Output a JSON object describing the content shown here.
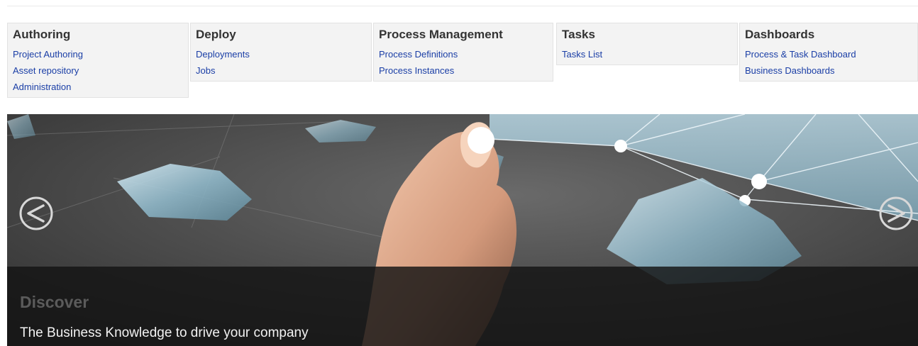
{
  "menu": [
    {
      "heading": "Authoring",
      "links": [
        "Project Authoring",
        "Asset repository",
        "Administration"
      ]
    },
    {
      "heading": "Deploy",
      "links": [
        "Deployments",
        "Jobs"
      ]
    },
    {
      "heading": "Process Management",
      "links": [
        "Process Definitions",
        "Process Instances"
      ]
    },
    {
      "heading": "Tasks",
      "links": [
        "Tasks List"
      ]
    },
    {
      "heading": "Dashboards",
      "links": [
        "Process & Task Dashboard",
        "Business Dashboards"
      ]
    }
  ],
  "carousel": {
    "title": "Discover",
    "subtitle": "The Business Knowledge to drive your company",
    "prev_icon": "chevron-left-circle",
    "next_icon": "chevron-right-circle"
  },
  "colors": {
    "link": "#1a3ea6",
    "heading": "#333333",
    "menu_bg": "#f3f3f3",
    "caption_bg": "#141414"
  }
}
